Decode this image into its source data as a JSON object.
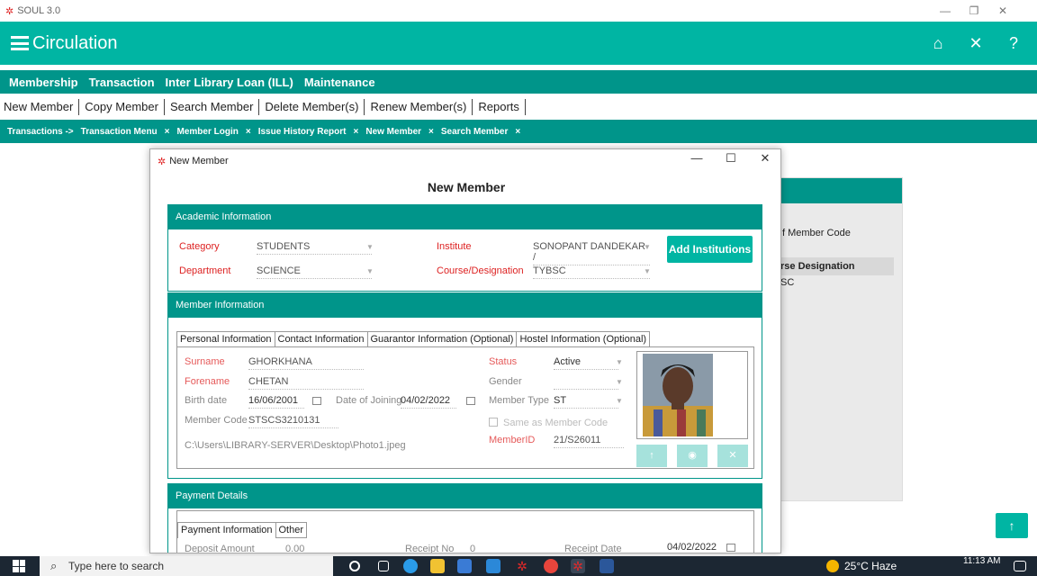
{
  "app": {
    "title": "SOUL 3.0"
  },
  "header": {
    "title": "Circulation"
  },
  "menubar": {
    "items": [
      "Membership",
      "Transaction",
      "Inter Library Loan (ILL)",
      "Maintenance"
    ]
  },
  "submenu": {
    "items": [
      "New Member",
      "Copy Member",
      "Search Member",
      "Delete Member(s)",
      "Renew Member(s)",
      "Reports"
    ]
  },
  "breadcrumbs": {
    "items": [
      "Transactions ->",
      "Transaction Menu",
      "×",
      "Member Login",
      "×",
      "Issue History Report",
      "×",
      "New Member",
      "×",
      "Search Member",
      "×"
    ]
  },
  "bgpanel": {
    "member_code_label": "f Member Code",
    "designation_header": "rse Designation",
    "designation_value": "SC"
  },
  "dialog": {
    "window_title": "New Member",
    "heading": "New Member",
    "academic": {
      "header": "Academic Information",
      "category_label": "Category",
      "category_value": "STUDENTS",
      "institute_label": "Institute",
      "institute_value": "SONOPANT DANDEKAR /",
      "department_label": "Department",
      "department_value": "SCIENCE",
      "course_label": "Course/Designation",
      "course_value": "TYBSC",
      "add_button": "Add Institutions"
    },
    "member": {
      "header": "Member Information",
      "tabs": [
        "Personal Information",
        "Contact Information",
        "Guarantor Information (Optional)",
        "Hostel Information (Optional)"
      ],
      "surname_label": "Surname",
      "surname_value": "GHORKHANA",
      "forename_label": "Forename",
      "forename_value": "CHETAN",
      "birth_label": "Birth date",
      "birth_value": "16/06/2001",
      "joining_label": "Date of Joining",
      "joining_value": "04/02/2022",
      "code_label": "Member Code",
      "code_value": "STSCS3210131",
      "path": "C:\\Users\\LIBRARY-SERVER\\Desktop\\Photo1.jpeg",
      "status_label": "Status",
      "status_value": "Active",
      "gender_label": "Gender",
      "type_label": "Member Type",
      "type_value": "ST",
      "same_as_label": "Same as Member Code",
      "memberid_label": "MemberID",
      "memberid_value": "21/S26011"
    },
    "payment": {
      "header": "Payment Details",
      "tabs": [
        "Payment Information",
        "Other"
      ],
      "deposit_label": "Deposit Amount",
      "deposit_value": "0.00",
      "receipt_label": "Receipt No",
      "receipt_value": "0",
      "receipt_date_label": "Receipt Date",
      "receipt_date_value": "04/02/2022"
    }
  },
  "taskbar": {
    "search_placeholder": "Type here to search",
    "weather": "25°C  Haze",
    "time": "11:13 AM"
  }
}
